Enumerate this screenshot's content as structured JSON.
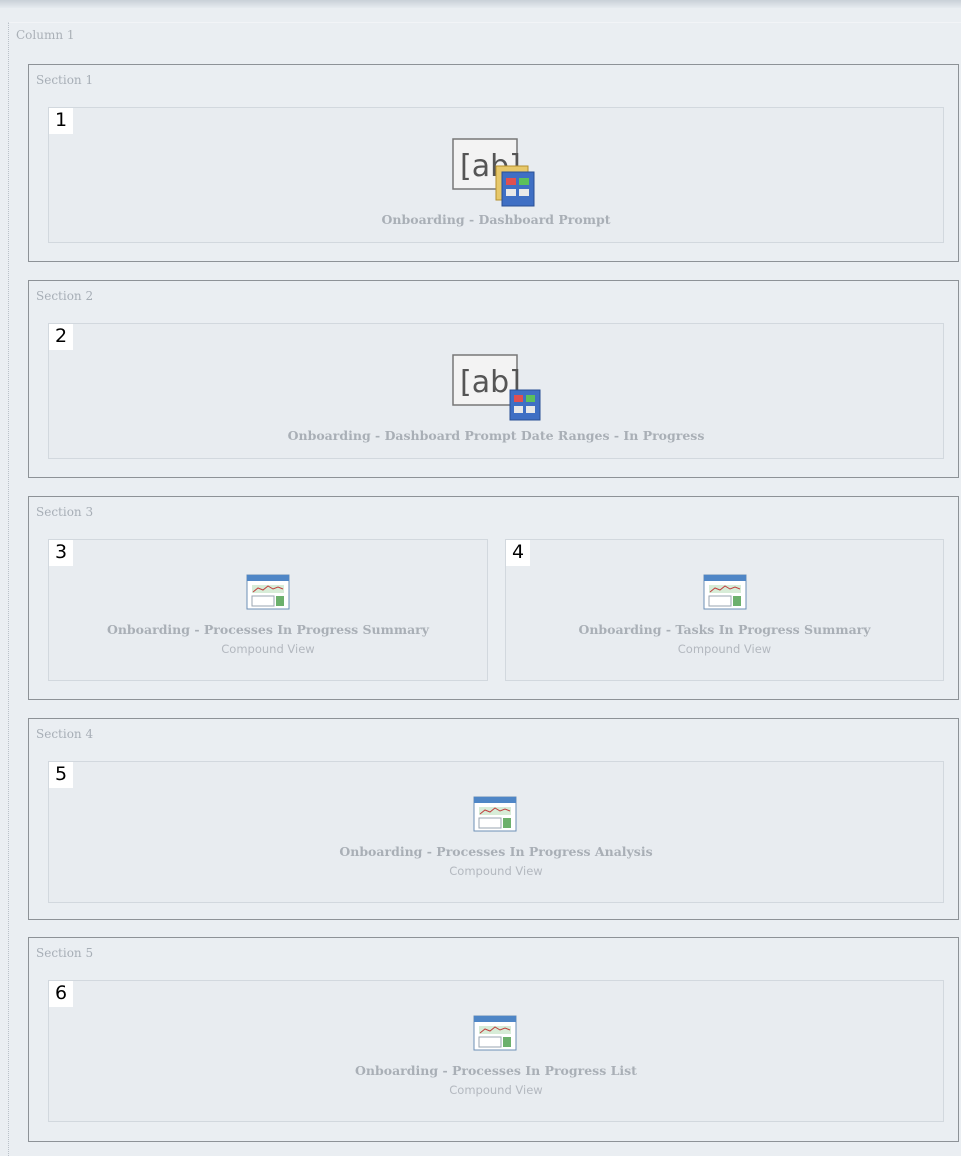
{
  "column": {
    "title": "Column 1"
  },
  "sections": [
    {
      "title": "Section 1",
      "views": [
        {
          "number": "1",
          "title": "Onboarding - Dashboard Prompt",
          "icon": "dashboard-prompt-icon"
        }
      ]
    },
    {
      "title": "Section 2",
      "views": [
        {
          "number": "2",
          "title": "Onboarding - Dashboard Prompt Date Ranges - In Progress",
          "icon": "dashboard-prompt-icon"
        }
      ]
    },
    {
      "title": "Section 3",
      "views": [
        {
          "number": "3",
          "title": "Onboarding - Processes In Progress Summary",
          "subtitle": "Compound View",
          "icon": "compound-view-icon"
        },
        {
          "number": "4",
          "title": "Onboarding - Tasks In Progress Summary",
          "subtitle": "Compound View",
          "icon": "compound-view-icon"
        }
      ]
    },
    {
      "title": "Section 4",
      "views": [
        {
          "number": "5",
          "title": "Onboarding - Processes In Progress Analysis",
          "subtitle": "Compound View",
          "icon": "compound-view-icon"
        }
      ]
    },
    {
      "title": "Section 5",
      "views": [
        {
          "number": "6",
          "title": "Onboarding - Processes In Progress List",
          "subtitle": "Compound View",
          "icon": "compound-view-icon"
        }
      ]
    }
  ]
}
